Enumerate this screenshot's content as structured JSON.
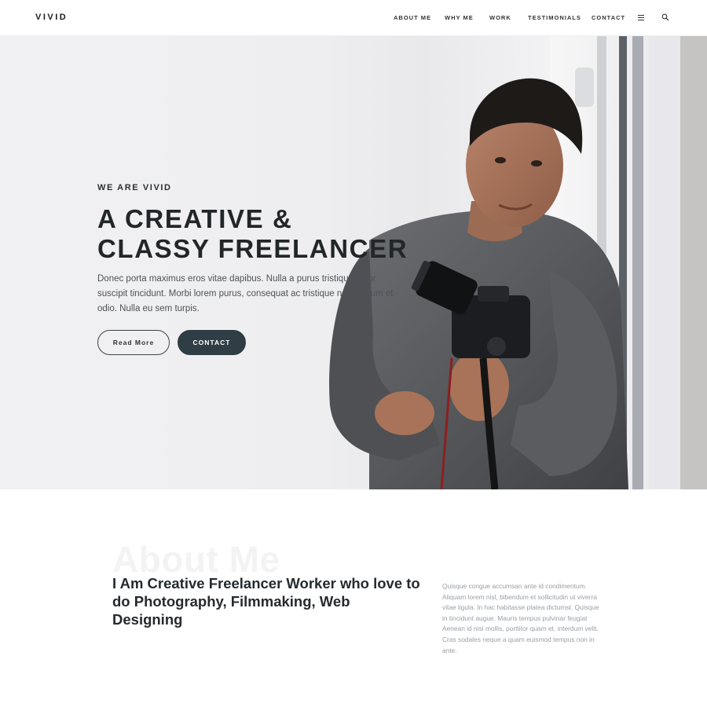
{
  "brand": {
    "logo": "VIVID"
  },
  "nav": {
    "items": [
      "ABOUT ME",
      "WHY ME",
      "WORK",
      "TESTIMONIALS",
      "CONTACT"
    ],
    "menu_icon": "hamburger-menu-icon",
    "search_icon": "search-icon"
  },
  "hero": {
    "eyebrow": "WE ARE VIVID",
    "headline": "A CREATIVE & CLASSY FREELANCER",
    "lead": "Donec porta maximus eros vitae dapibus. Nulla a purus tristique dolor suscipit tincidunt. Morbi lorem purus, consequat ac tristique nec, dictum et odio. Nulla eu sem turpis.",
    "read_more": "Read More",
    "contact": "CONTACT"
  },
  "about": {
    "ghost_title": "About Me",
    "heading": "I Am Creative Freelancer Worker who love to do Photography, Filmmaking, Web Designing",
    "body": "Quisque congue accumsan ante id condimentum. Aliquam lorem nisl, bibendum et sollicitudin ut viverra vitae ligula. In hac habitasse platea dictumst. Quisque in tincidunt augue. Mauris tempus pulvinar feugiat Aenean id nisi mollis, porttitor quam et, interdum velit. Cras sodales neque a quam euismod tempus non in ante."
  },
  "colors": {
    "accent_dark": "#2f3d44",
    "text_dark": "#222629",
    "muted": "#9a9ea3"
  }
}
